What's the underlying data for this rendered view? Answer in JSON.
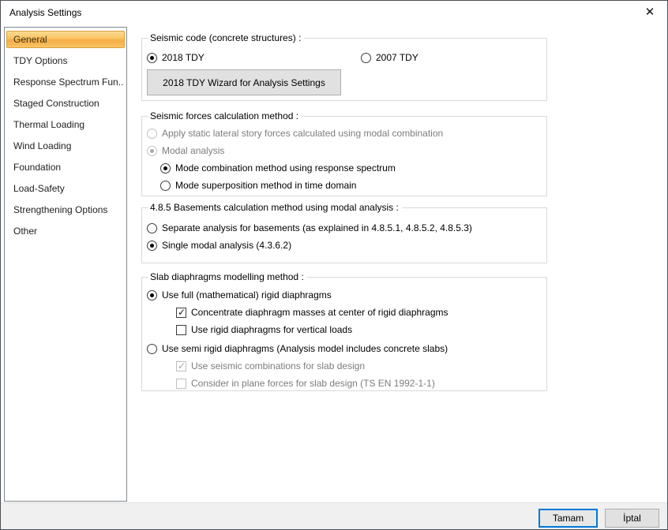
{
  "window": {
    "title": "Analysis Settings",
    "close_glyph": "✕"
  },
  "sidebar": {
    "items": [
      {
        "label": "General",
        "selected": true
      },
      {
        "label": "TDY Options",
        "selected": false
      },
      {
        "label": "Response Spectrum Fun...",
        "selected": false
      },
      {
        "label": "Staged Construction",
        "selected": false
      },
      {
        "label": "Thermal Loading",
        "selected": false
      },
      {
        "label": "Wind Loading",
        "selected": false
      },
      {
        "label": "Foundation",
        "selected": false
      },
      {
        "label": "Load-Safety",
        "selected": false
      },
      {
        "label": "Strengthening Options",
        "selected": false
      },
      {
        "label": "Other",
        "selected": false
      }
    ]
  },
  "seismic_code_group": {
    "title": "Seismic code (concrete structures) :",
    "radio_2018": {
      "label": "2018 TDY",
      "checked": true
    },
    "radio_2007": {
      "label": "2007 TDY",
      "checked": false
    },
    "wizard_button_label": "2018 TDY Wizard for Analysis Settings"
  },
  "groups": [
    {
      "title": "Seismic forces calculation method :",
      "rows": [
        {
          "type": "radio",
          "label": "Apply static lateral story forces calculated using modal combination",
          "checked": false,
          "disabled": true,
          "indent": 0
        },
        {
          "type": "radio",
          "label": "Modal analysis",
          "checked": true,
          "disabled": true,
          "indent": 0
        },
        {
          "type": "radio",
          "label": "Mode combination method using response spectrum",
          "checked": true,
          "disabled": false,
          "indent": 1
        },
        {
          "type": "radio",
          "label": "Mode superposition method in time domain",
          "checked": false,
          "disabled": false,
          "indent": 1
        }
      ]
    },
    {
      "title": "4.8.5 Basements calculation method using modal analysis :",
      "rows": [
        {
          "type": "radio",
          "label": "Separate analysis for basements (as explained in 4.8.5.1, 4.8.5.2, 4.8.5.3)",
          "checked": false,
          "disabled": false,
          "indent": 0
        },
        {
          "type": "radio",
          "label": "Single modal analysis (4.3.6.2)",
          "checked": true,
          "disabled": false,
          "indent": 0
        }
      ]
    },
    {
      "title": "Slab diaphragms modelling method :",
      "rows": [
        {
          "type": "radio",
          "label": "Use full (mathematical) rigid diaphragms",
          "checked": true,
          "disabled": false,
          "indent": 0
        },
        {
          "type": "checkbox",
          "label": "Concentrate diaphragm masses at center of rigid diaphragms",
          "checked": true,
          "disabled": false,
          "indent": 2
        },
        {
          "type": "checkbox",
          "label": "Use rigid diaphragms for vertical loads",
          "checked": false,
          "disabled": false,
          "indent": 2
        },
        {
          "type": "radio",
          "label": "Use semi rigid diaphragms (Analysis model includes concrete slabs)",
          "checked": false,
          "disabled": false,
          "indent": 0,
          "gap_before": true
        },
        {
          "type": "checkbox",
          "label": "Use seismic combinations for slab design",
          "checked": true,
          "disabled": true,
          "indent": 2
        },
        {
          "type": "checkbox",
          "label": "Consider in plane forces for slab design (TS EN 1992-1-1)",
          "checked": false,
          "disabled": true,
          "indent": 2
        }
      ]
    }
  ],
  "footer": {
    "ok_label": "Tamam",
    "cancel_label": "İptal"
  },
  "colors": {
    "accent_blue": "#0078d7",
    "selected_item_border": "#dd9f3d",
    "selected_item_gradient_top": "#fbda90",
    "selected_item_gradient_bottom": "#f5ae44",
    "disabled_text": "#7d7d7d"
  }
}
